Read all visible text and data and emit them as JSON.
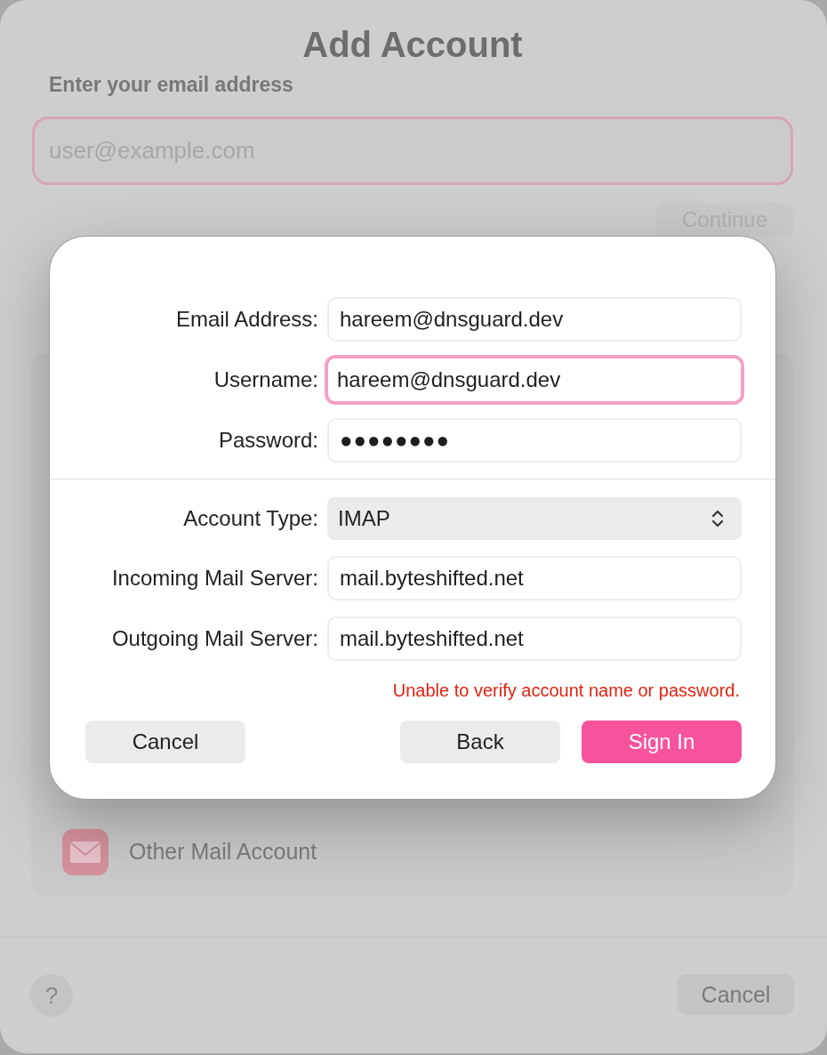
{
  "window": {
    "title": "Add Account",
    "prompt": "Enter your email address",
    "email_field": {
      "placeholder": "user@example.com",
      "focused": true
    },
    "continue_button": {
      "label": "Continue",
      "disabled": true
    },
    "providers": [
      {
        "label": "Other Mail Account"
      }
    ],
    "help_button": {
      "label": "?"
    },
    "cancel_button": {
      "label": "Cancel"
    }
  },
  "sheet": {
    "account_fields": [
      {
        "kind": "text",
        "label": "Email Address:",
        "value": "hareem@dnsguard.dev",
        "focused": false
      },
      {
        "kind": "text",
        "label": "Username:",
        "value": "hareem@dnsguard.dev",
        "focused": true
      },
      {
        "kind": "password",
        "label": "Password:",
        "value": "●●●●●●●●",
        "focused": false
      }
    ],
    "server_fields": [
      {
        "kind": "popup",
        "label": "Account Type:",
        "value": "IMAP"
      },
      {
        "kind": "text",
        "label": "Incoming Mail Server:",
        "value": "mail.byteshifted.net",
        "focused": false
      },
      {
        "kind": "text",
        "label": "Outgoing Mail Server:",
        "value": "mail.byteshifted.net",
        "focused": false
      }
    ],
    "error": "Unable to verify account name or password.",
    "buttons": [
      {
        "kind": "dismiss",
        "label": "Cancel"
      },
      {
        "kind": "secondary",
        "label": "Back"
      },
      {
        "kind": "primary",
        "label": "Sign In"
      }
    ]
  }
}
